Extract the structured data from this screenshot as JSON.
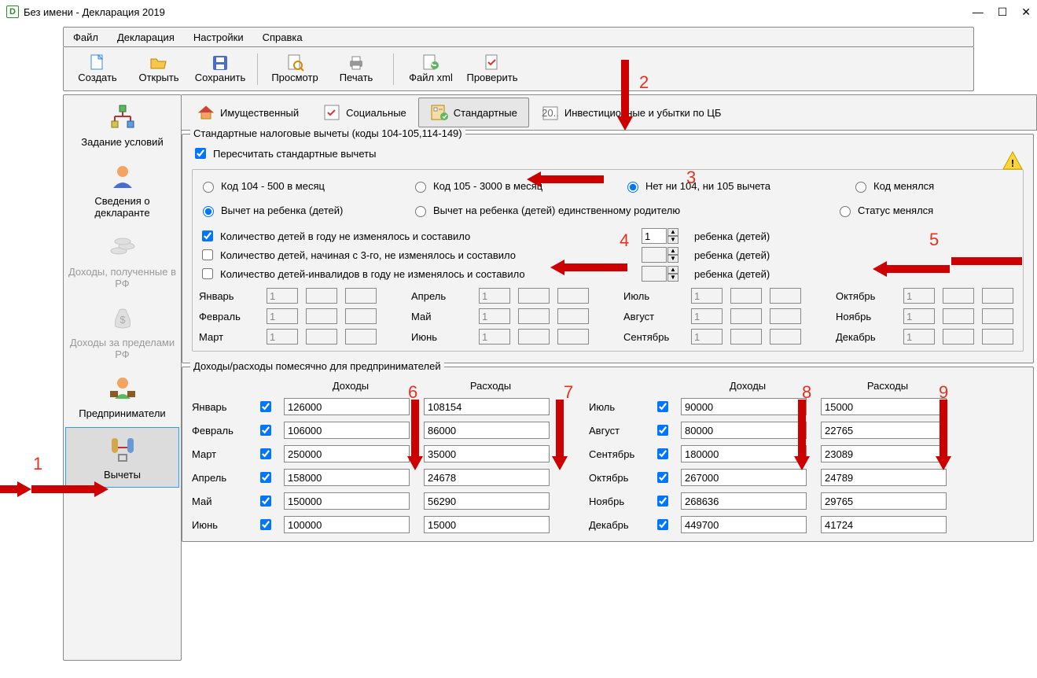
{
  "window": {
    "title": "Без имени - Декларация 2019"
  },
  "menu": {
    "file": "Файл",
    "decl": "Декларация",
    "settings": "Настройки",
    "help": "Справка"
  },
  "toolbar": {
    "create": "Создать",
    "open": "Открыть",
    "save": "Сохранить",
    "preview": "Просмотр",
    "print": "Печать",
    "xml": "Файл xml",
    "check": "Проверить"
  },
  "sidebar": {
    "cond": "Задание условий",
    "declarant": "Сведения о декларанте",
    "income_rf": "Доходы, полученные в РФ",
    "income_abroad": "Доходы за пределами РФ",
    "entrepreneur": "Предприниматели",
    "deductions": "Вычеты"
  },
  "tabs": {
    "property": "Имущественный",
    "social": "Социальные",
    "standard": "Стандартные",
    "invest": "Инвестиционные и убытки по ЦБ"
  },
  "group1": {
    "title": "Стандартные налоговые вычеты (коды 104-105,114-149)",
    "recalc": "Пересчитать стандартные вычеты",
    "code104": "Код 104 - 500 в месяц",
    "code105": "Код 105 - 3000 в месяц",
    "nocode": "Нет ни 104, ни 105 вычета",
    "codechange": "Код менялся",
    "child": "Вычет на ребенка (детей)",
    "child_single": "Вычет на ребенка (детей) единственному родителю",
    "status_change": "Статус менялся",
    "children_const": "Количество детей в году не изменялось и составило",
    "children3_const": "Количество детей, начиная с 3-го, не изменялось и составило",
    "children_inv_const": "Количество детей-инвалидов в году не изменялось и составило",
    "child_suffix": "ребенка (детей)",
    "children_value": "1",
    "months": {
      "jan": "Январь",
      "feb": "Февраль",
      "mar": "Март",
      "apr": "Апрель",
      "may": "Май",
      "jun": "Июнь",
      "jul": "Июль",
      "aug": "Август",
      "sep": "Сентябрь",
      "oct": "Октябрь",
      "nov": "Ноябрь",
      "dec": "Декабрь"
    },
    "mval": "1"
  },
  "group2": {
    "title": "Доходы/расходы помесячно для предпринимателей",
    "income_h": "Доходы",
    "expense_h": "Расходы",
    "rows": [
      {
        "m": "Январь",
        "i": "126000",
        "e": "108154"
      },
      {
        "m": "Февраль",
        "i": "106000",
        "e": "86000"
      },
      {
        "m": "Март",
        "i": "250000",
        "e": "35000"
      },
      {
        "m": "Апрель",
        "i": "158000",
        "e": "24678"
      },
      {
        "m": "Май",
        "i": "150000",
        "e": "56290"
      },
      {
        "m": "Июнь",
        "i": "100000",
        "e": "15000"
      }
    ],
    "rows2": [
      {
        "m": "Июль",
        "i": "90000",
        "e": "15000"
      },
      {
        "m": "Август",
        "i": "80000",
        "e": "22765"
      },
      {
        "m": "Сентябрь",
        "i": "180000",
        "e": "23089"
      },
      {
        "m": "Октябрь",
        "i": "267000",
        "e": "24789"
      },
      {
        "m": "Ноябрь",
        "i": "268636",
        "e": "29765"
      },
      {
        "m": "Декабрь",
        "i": "449700",
        "e": "41724"
      }
    ]
  },
  "ann": {
    "n1": "1",
    "n2": "2",
    "n3": "3",
    "n4": "4",
    "n5": "5",
    "n6": "6",
    "n7": "7",
    "n8": "8",
    "n9": "9"
  }
}
